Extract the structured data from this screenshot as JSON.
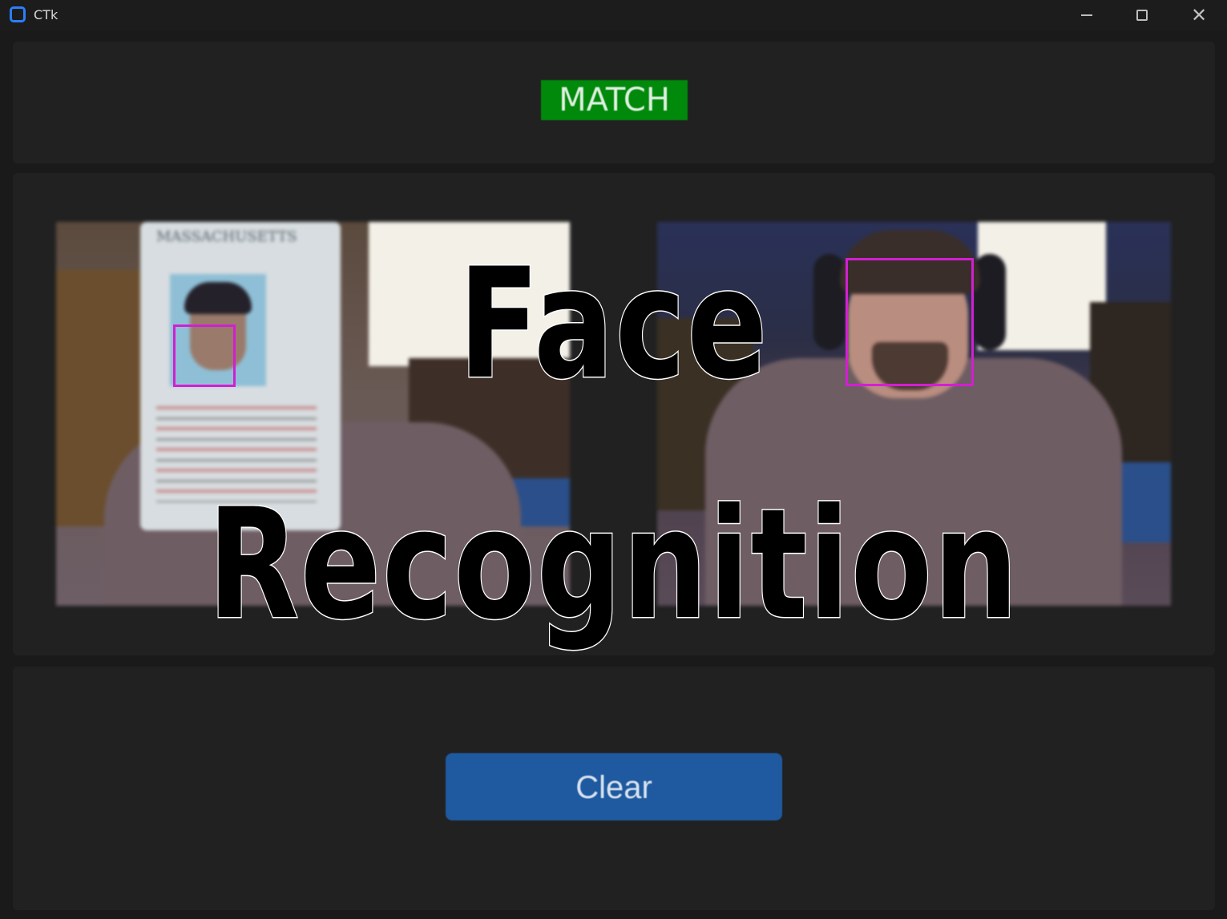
{
  "window": {
    "title": "CTk",
    "minimize_icon": "minimize-icon",
    "maximize_icon": "maximize-icon",
    "close_icon": "close-icon",
    "close_glyph": "✕"
  },
  "status": {
    "label": "MATCH",
    "color": "#00890b"
  },
  "images": {
    "left": {
      "description_icon": "id-card-photo",
      "face_box_color": "#d21fd2",
      "card_header": "MASSACHUSETTS"
    },
    "right": {
      "description_icon": "webcam-photo",
      "face_box_color": "#d21fd2"
    }
  },
  "overlay": {
    "line1": "Face",
    "line2": "Recognition"
  },
  "actions": {
    "clear_label": "Clear",
    "clear_color": "#1f5aa0"
  }
}
